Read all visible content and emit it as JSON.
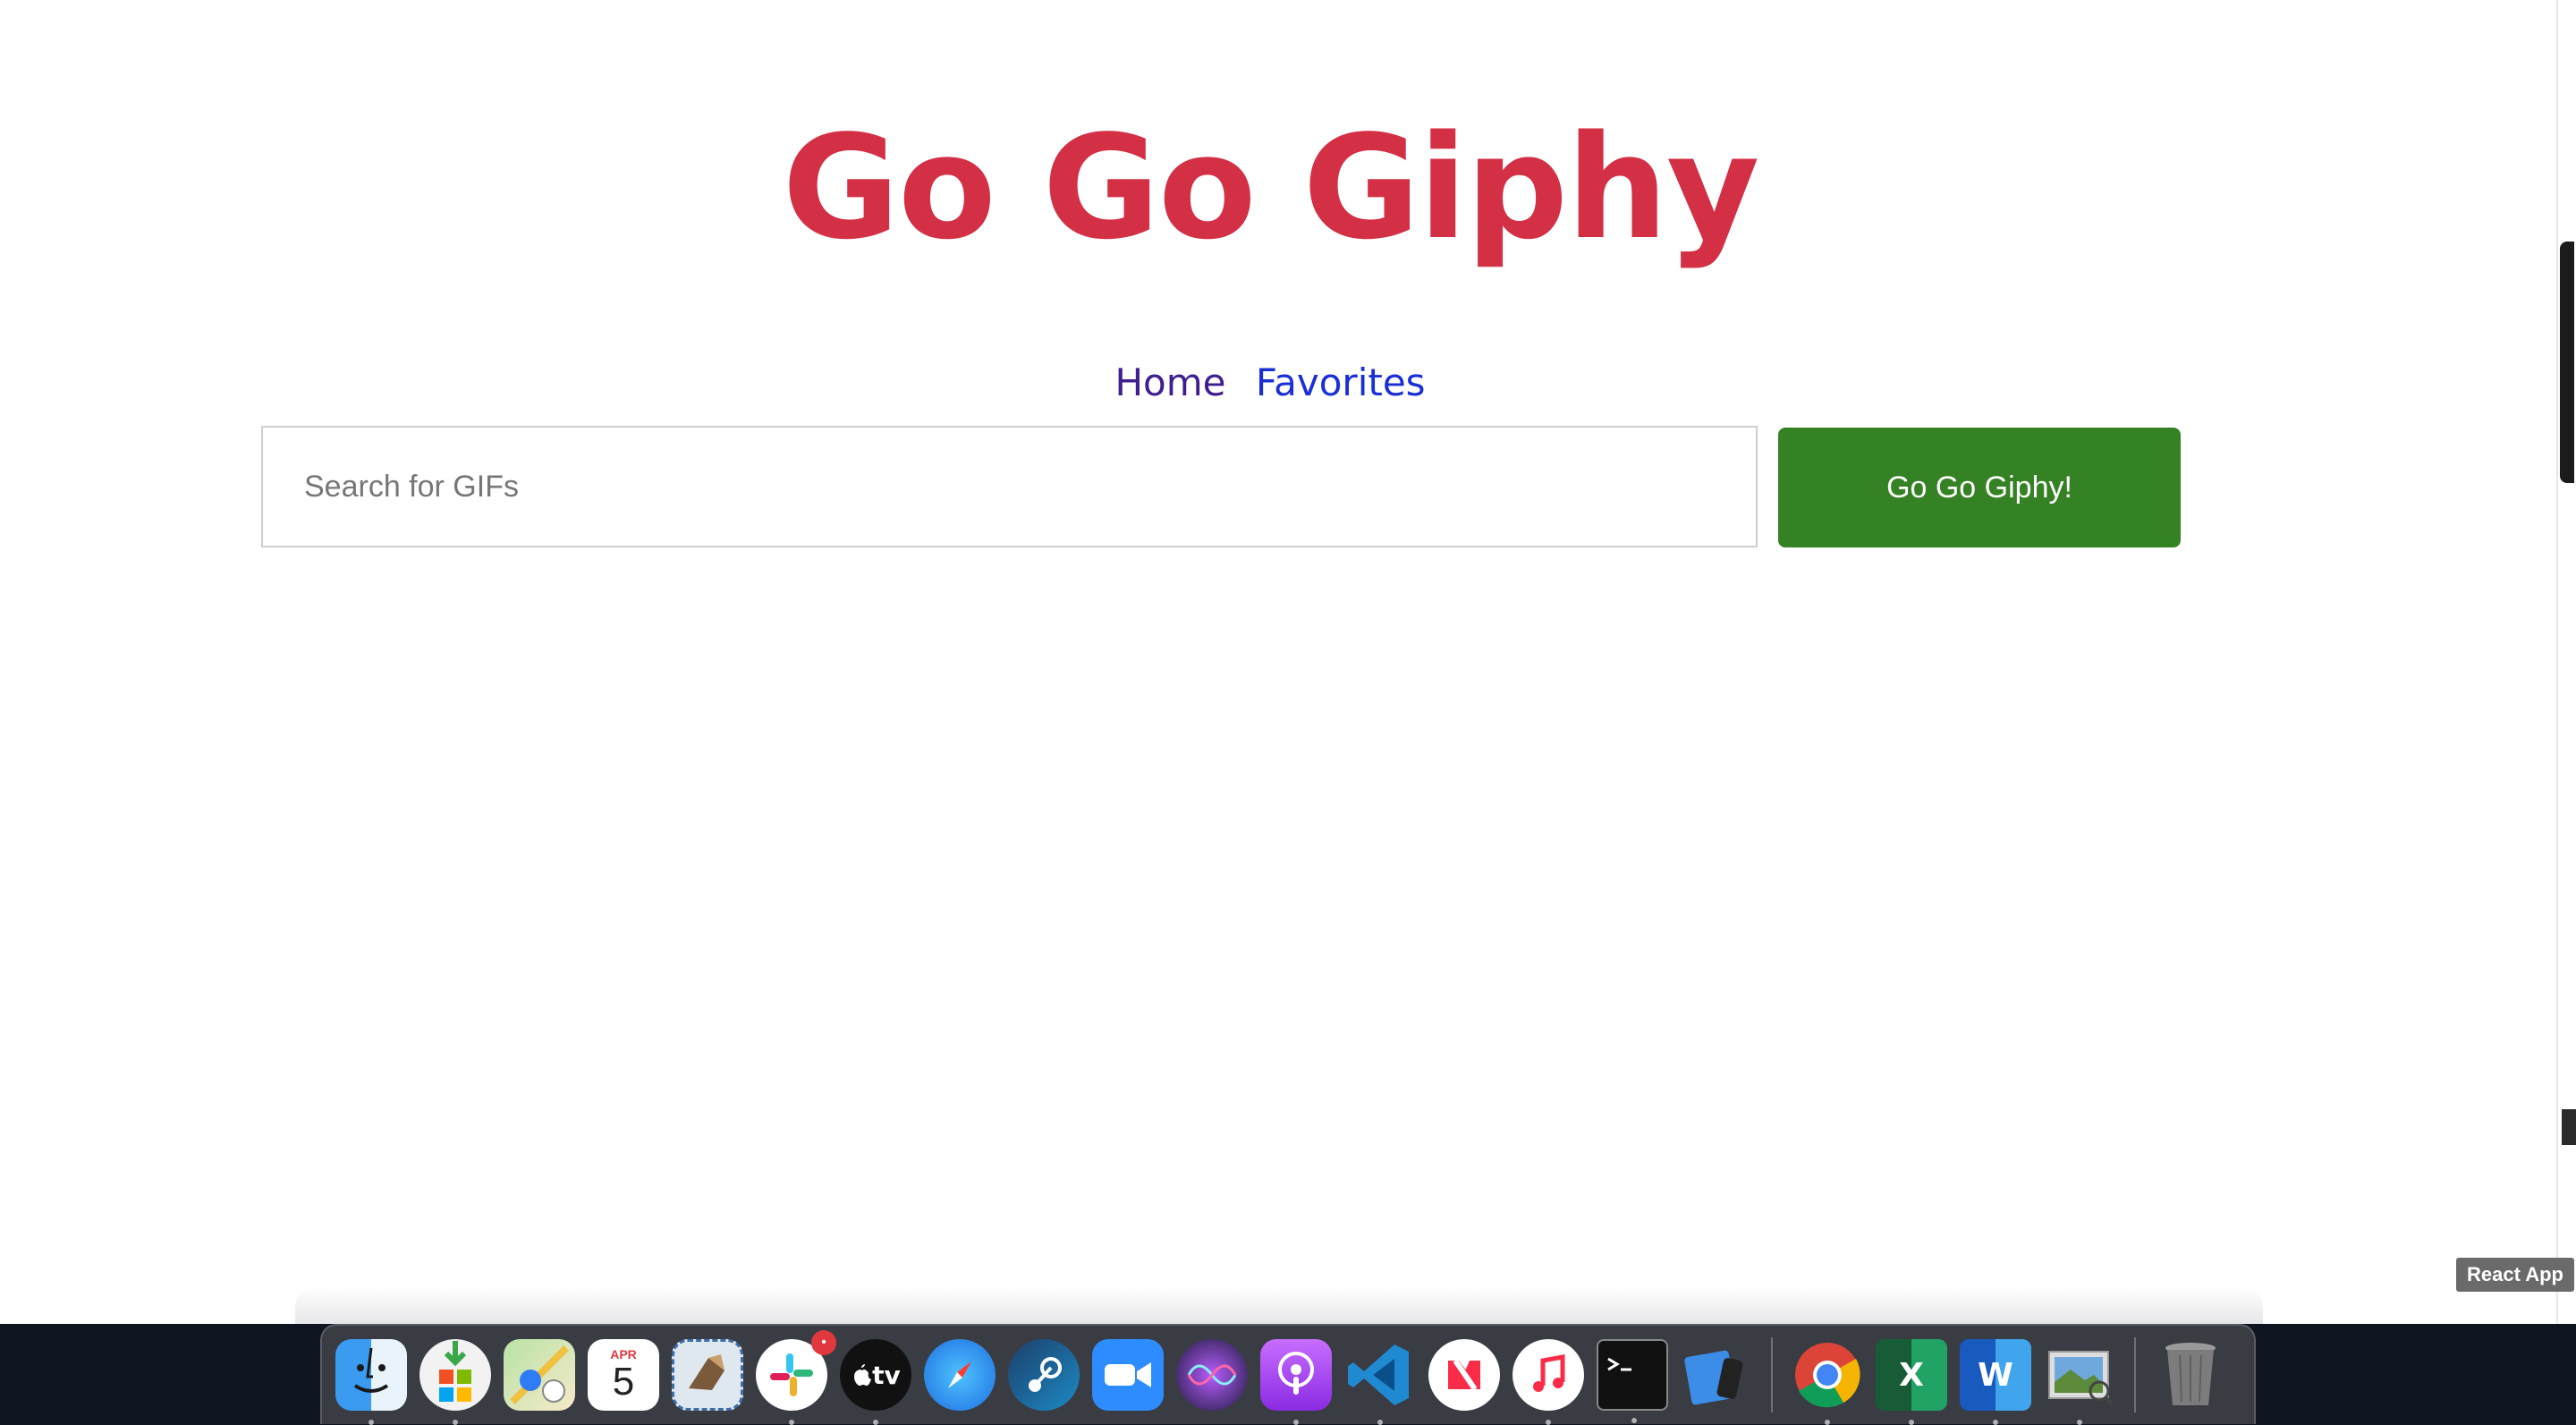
{
  "app": {
    "title": "Go Go Giphy",
    "title_color": "#d32f45"
  },
  "nav": {
    "items": [
      {
        "label": "Home",
        "color": "#3f1f8f"
      },
      {
        "label": "Favorites",
        "color": "#1a2fd6"
      }
    ]
  },
  "search": {
    "placeholder": "Search for GIFs",
    "value": "",
    "button_label": "Go Go Giphy!",
    "button_color": "#358224"
  },
  "tooltip": {
    "text": "React App"
  },
  "dock": {
    "items": [
      {
        "name": "finder",
        "icon": "finder-icon",
        "running": true
      },
      {
        "name": "installer",
        "icon": "installer-icon",
        "running": true
      },
      {
        "name": "maps",
        "icon": "maps-icon",
        "running": false
      },
      {
        "name": "calendar",
        "icon": "calendar-icon",
        "running": false,
        "month": "APR",
        "day": "5"
      },
      {
        "name": "mail",
        "icon": "mail-icon",
        "running": false
      },
      {
        "name": "slack",
        "icon": "slack-icon",
        "running": true,
        "badge": "•"
      },
      {
        "name": "apple-tv",
        "icon": "apple-tv-icon",
        "running": true,
        "label": "tv"
      },
      {
        "name": "safari",
        "icon": "safari-icon",
        "running": false
      },
      {
        "name": "steam",
        "icon": "steam-icon",
        "running": false
      },
      {
        "name": "zoom",
        "icon": "zoom-icon",
        "running": false
      },
      {
        "name": "siri",
        "icon": "siri-icon",
        "running": false
      },
      {
        "name": "podcasts",
        "icon": "podcasts-icon",
        "running": true
      },
      {
        "name": "vscode",
        "icon": "vscode-icon",
        "running": true
      },
      {
        "name": "news",
        "icon": "news-icon",
        "running": false
      },
      {
        "name": "music",
        "icon": "music-icon",
        "running": true
      },
      {
        "name": "terminal",
        "icon": "terminal-icon",
        "running": true
      },
      {
        "name": "simulator",
        "icon": "simulator-icon",
        "running": false
      },
      {
        "name": "chrome",
        "icon": "chrome-icon",
        "running": true
      },
      {
        "name": "excel",
        "icon": "excel-icon",
        "running": true,
        "label": "X"
      },
      {
        "name": "word",
        "icon": "word-icon",
        "running": true,
        "label": "W"
      },
      {
        "name": "preview",
        "icon": "preview-icon",
        "running": true
      },
      {
        "name": "trash",
        "icon": "trash-icon",
        "running": false
      }
    ]
  }
}
